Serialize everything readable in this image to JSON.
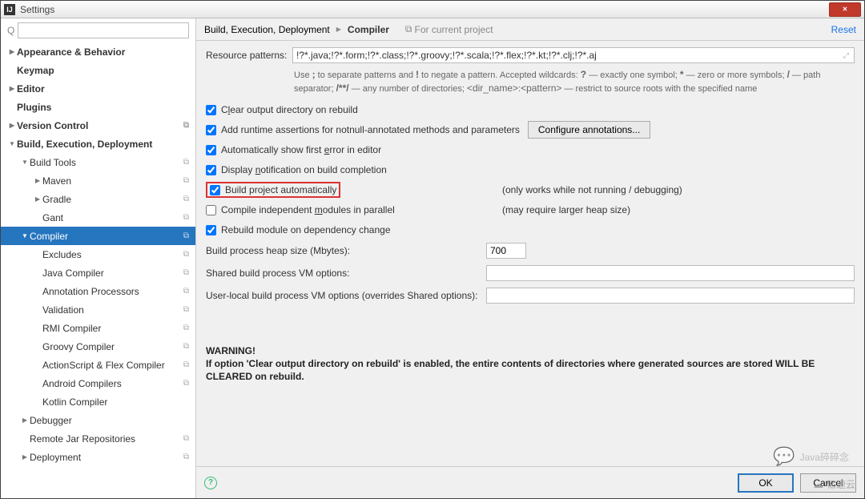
{
  "window": {
    "title": "Settings",
    "close": "✕"
  },
  "search": {
    "placeholder": ""
  },
  "tree": {
    "appearance": "Appearance & Behavior",
    "keymap": "Keymap",
    "editor": "Editor",
    "plugins": "Plugins",
    "vcs": "Version Control",
    "bed": "Build, Execution, Deployment",
    "build_tools": "Build Tools",
    "maven": "Maven",
    "gradle": "Gradle",
    "gant": "Gant",
    "compiler": "Compiler",
    "excludes": "Excludes",
    "java_compiler": "Java Compiler",
    "annotation": "Annotation Processors",
    "validation": "Validation",
    "rmi": "RMI Compiler",
    "groovy": "Groovy Compiler",
    "as_flex": "ActionScript & Flex Compiler",
    "android": "Android Compilers",
    "kotlin": "Kotlin Compiler",
    "debugger": "Debugger",
    "remote_jar": "Remote Jar Repositories",
    "deployment": "Deployment"
  },
  "breadcrumb": {
    "parent": "Build, Execution, Deployment",
    "current": "Compiler",
    "hint": "For current project",
    "reset": "Reset"
  },
  "settings": {
    "resource_patterns_label": "Resource patterns:",
    "resource_patterns_value": "!?*.java;!?*.form;!?*.class;!?*.groovy;!?*.scala;!?*.flex;!?*.kt;!?*.clj;!?*.aj",
    "help1": "Use ; to separate patterns and ! to negate a pattern. Accepted wildcards: ? — exactly one symbol; * — zero or more symbols; / — path separator; /**/ — any number of directories; <dir_name>:<pattern> — restrict to source roots with the specified name",
    "clear_output": "Clear output directory on rebuild",
    "add_runtime": "Add runtime assertions for notnull-annotated methods and parameters",
    "configure_btn": "Configure annotations...",
    "auto_first_error": "Automatically show first error in editor",
    "display_notif": "Display notification on build completion",
    "build_auto": "Build project automatically",
    "build_auto_note": "(only works while not running / debugging)",
    "compile_independent": "Compile independent modules in parallel",
    "compile_independent_note": "(may require larger heap size)",
    "rebuild_module": "Rebuild module on dependency change",
    "heap_label": "Build process heap size (Mbytes):",
    "heap_value": "700",
    "shared_vm_label": "Shared build process VM options:",
    "shared_vm_value": "",
    "user_vm_label": "User-local build process VM options (overrides Shared options):",
    "user_vm_value": "",
    "warning_title": "WARNING!",
    "warning_text": "If option 'Clear output directory on rebuild' is enabled, the entire contents of directories where generated sources are stored WILL BE CLEARED on rebuild."
  },
  "footer": {
    "ok": "OK",
    "cancel": "Cancel"
  },
  "watermark": {
    "text1": "Java碎碎念",
    "text2": "亿速云"
  }
}
